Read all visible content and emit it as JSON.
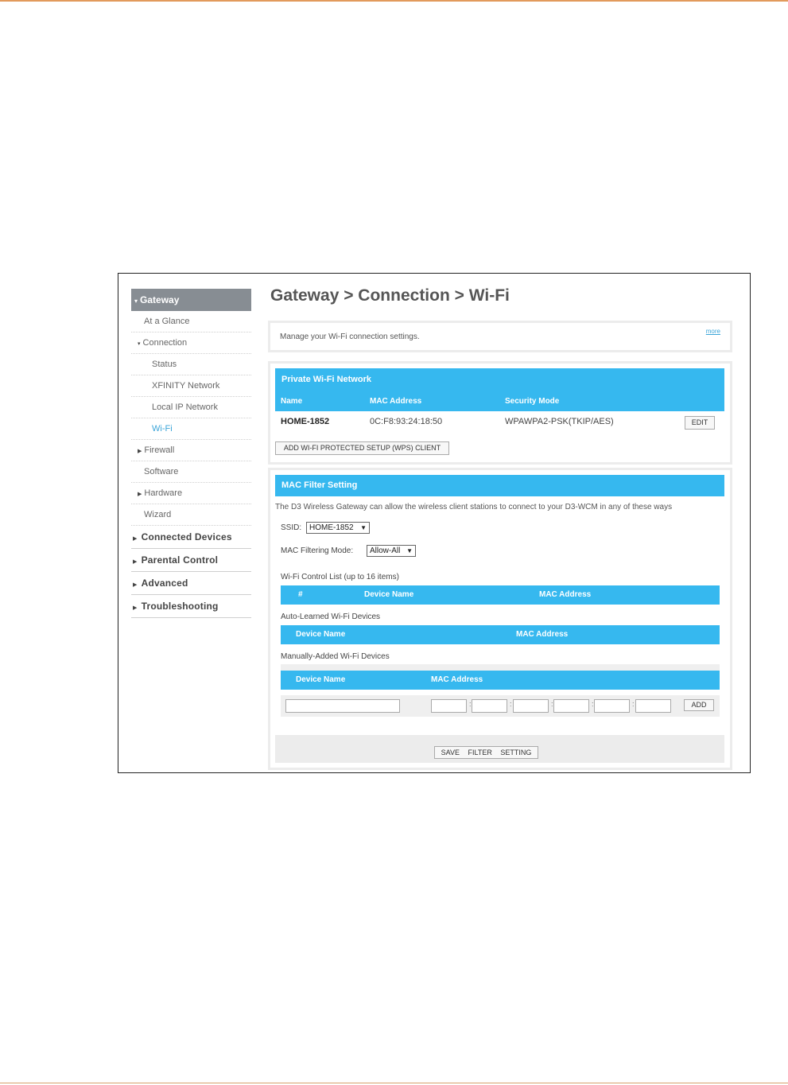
{
  "sidebar": {
    "gateway": "Gateway",
    "items": [
      {
        "label": "At a Glance"
      },
      {
        "label": "Connection"
      },
      {
        "label": "Status"
      },
      {
        "label": "XFINITY Network"
      },
      {
        "label": "Local IP Network"
      },
      {
        "label": "Wi-Fi"
      },
      {
        "label": "Firewall"
      },
      {
        "label": "Software"
      },
      {
        "label": "Hardware"
      },
      {
        "label": "Wizard"
      }
    ],
    "main_items": [
      {
        "label": "Connected Devices"
      },
      {
        "label": "Parental Control"
      },
      {
        "label": "Advanced"
      },
      {
        "label": "Troubleshooting"
      }
    ]
  },
  "page_title": "Gateway > Connection > Wi-Fi",
  "intro": {
    "text": "Manage your Wi-Fi connection settings.",
    "more": "more"
  },
  "private_wifi": {
    "title": "Private Wi-Fi Network",
    "columns": [
      "Name",
      "MAC Address",
      "Security Mode"
    ],
    "row": {
      "name": "HOME-1852",
      "mac": "0C:F8:93:24:18:50",
      "security": "WPAWPA2-PSK(TKIP/AES)",
      "edit": "EDIT"
    },
    "wps_button": "ADD WI-FI PROTECTED SETUP (WPS) CLIENT"
  },
  "mac_filter": {
    "title": "MAC Filter Setting",
    "description": "The D3 Wireless Gateway can allow the wireless client stations to connect to your D3-WCM in any of these ways",
    "ssid_label": "SSID:",
    "ssid_value": "HOME-1852",
    "mode_label": "MAC Filtering Mode:",
    "mode_value": "Allow-All",
    "control_list_label": "Wi-Fi Control List (up to 16 items)",
    "control_list_columns": [
      "#",
      "Device Name",
      "MAC Address"
    ],
    "auto_learned_label": "Auto-Learned Wi-Fi Devices",
    "auto_learned_columns": [
      "Device Name",
      "MAC Address"
    ],
    "manual_label": "Manually-Added Wi-Fi Devices",
    "manual_columns": [
      "Device Name",
      "MAC Address"
    ],
    "add_button": "ADD",
    "save_button": "SAVE FILTER SETTING"
  },
  "colors": {
    "accent_blue": "#36b8ef",
    "sidebar_header": "#878d93",
    "active_link": "#3aa4d8",
    "page_rule": "#e29a5c"
  }
}
